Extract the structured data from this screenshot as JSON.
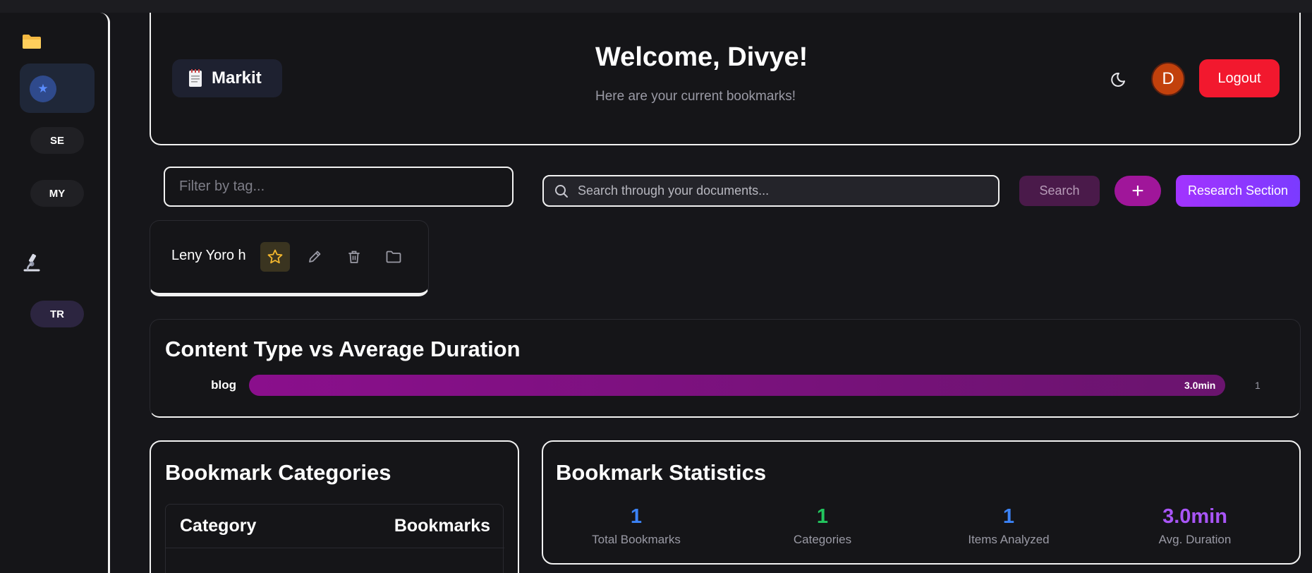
{
  "sidebar": {
    "items": [
      {
        "label": "SE"
      },
      {
        "label": "MY"
      },
      {
        "label": "TR"
      }
    ]
  },
  "header": {
    "app_name": "Markit",
    "welcome": "Welcome, Divye!",
    "subtitle": "Here are your current bookmarks!",
    "avatar_initial": "D",
    "logout_label": "Logout"
  },
  "toolbar": {
    "tag_filter_placeholder": "Filter by tag...",
    "search_placeholder": "Search through your documents...",
    "search_label": "Search",
    "add_label": "+",
    "research_label": "Research Section"
  },
  "bookmark": {
    "title": "Leny Yoro h"
  },
  "chart_section": {
    "title": "Content Type vs Average Duration"
  },
  "chart_data": {
    "type": "bar",
    "orientation": "horizontal",
    "title": "Content Type vs Average Duration",
    "categories": [
      "blog"
    ],
    "values": [
      3.0
    ],
    "value_labels": [
      "3.0min"
    ],
    "counts": [
      1
    ],
    "xlim": [
      0,
      3.0
    ]
  },
  "categories_card": {
    "title": "Bookmark Categories",
    "col_category": "Category",
    "col_bookmarks": "Bookmarks"
  },
  "stats_card": {
    "title": "Bookmark Statistics",
    "stats": [
      {
        "value": "1",
        "label": "Total Bookmarks",
        "color": "#3b82f6"
      },
      {
        "value": "1",
        "label": "Categories",
        "color": "#22c55e"
      },
      {
        "value": "1",
        "label": "Items Analyzed",
        "color": "#3b82f6"
      },
      {
        "value": "3.0min",
        "label": "Avg. Duration",
        "color": "#a855f7"
      }
    ]
  },
  "colors": {
    "background": "#16161a",
    "logout": "#f2182e",
    "accent_purple": "#a233ff",
    "bar": "#8a0f8c"
  }
}
